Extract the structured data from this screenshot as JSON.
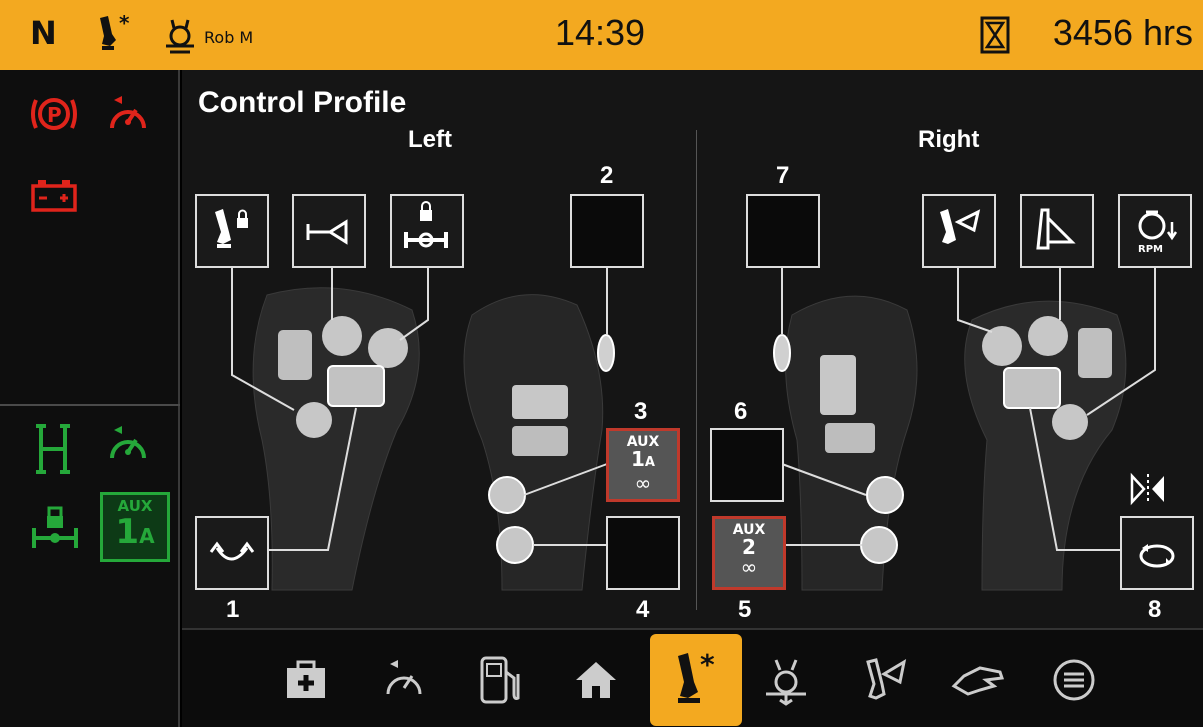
{
  "status_bar": {
    "gear": "N",
    "user_name": "Rob M",
    "time": "14:39",
    "hours": "3456 hrs"
  },
  "page": {
    "title": "Control Profile",
    "left_label": "Left",
    "right_label": "Right"
  },
  "left_functions": [
    {
      "icon": "joystick-lock-icon"
    },
    {
      "icon": "horn-icon"
    },
    {
      "icon": "axle-lock-icon"
    }
  ],
  "right_functions": [
    {
      "icon": "loader-arm-icon"
    },
    {
      "icon": "boom-angle-icon"
    },
    {
      "icon": "engine-rpm-down-icon"
    }
  ],
  "button_numbers": {
    "b1": "1",
    "b2": "2",
    "b3": "3",
    "b4": "4",
    "b5": "5",
    "b6": "6",
    "b7": "7",
    "b8": "8"
  },
  "aux1": {
    "line1": "AUX",
    "line2": "1",
    "sub": "A",
    "line3": "∞"
  },
  "aux2": {
    "line1": "AUX",
    "line2": "2",
    "line3": "∞"
  },
  "rpm_label": "RPM",
  "sidebar_aux": {
    "line1": "AUX",
    "line2": "1",
    "sub": "A"
  },
  "nav": [
    {
      "icon": "first-aid-icon",
      "active": false
    },
    {
      "icon": "speed-control-icon",
      "active": false
    },
    {
      "icon": "fuel-icon",
      "active": false
    },
    {
      "icon": "home-icon",
      "active": false
    },
    {
      "icon": "joystick-settings-icon",
      "active": true
    },
    {
      "icon": "hydraulics-icon",
      "active": false
    },
    {
      "icon": "loader-icon",
      "active": false
    },
    {
      "icon": "hand-control-icon",
      "active": false
    },
    {
      "icon": "menu-icon",
      "active": false
    }
  ],
  "colors": {
    "accent": "#f3a920",
    "warning_red": "#e0241b",
    "status_green": "#25a83a",
    "aux_border": "#c0392b"
  }
}
